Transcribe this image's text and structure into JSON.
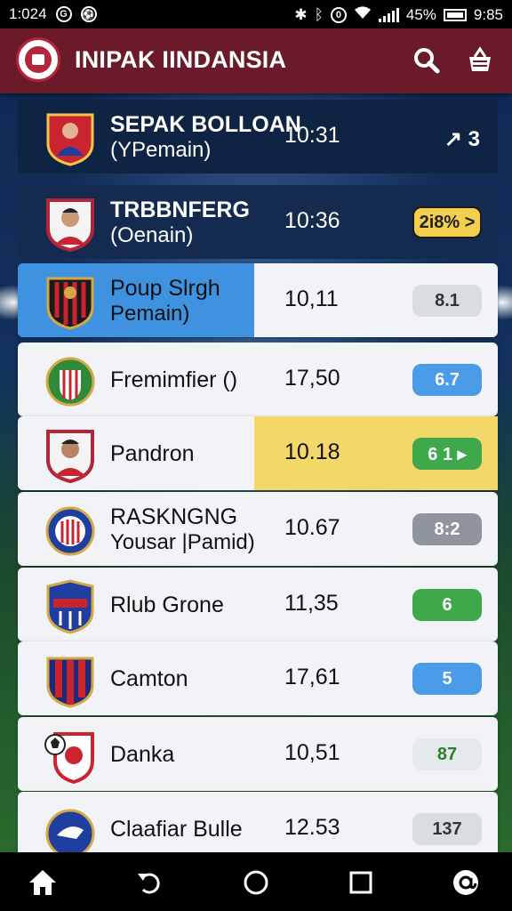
{
  "status_bar": {
    "time_left": "1:024",
    "battery_pct": "45%",
    "time_right": "9:85"
  },
  "app": {
    "title": "INIPAK IINDANSIA",
    "brand_color": "#6a1a28"
  },
  "rows": [
    {
      "name": "SEPAK BOLLOAN",
      "sub": "(YPemain)",
      "time": "10:31",
      "action": "↗ 3",
      "style": "dark"
    },
    {
      "name": "TRBBNFERG",
      "sub": "(Oenain)",
      "time": "10:36",
      "action": "2i8% >",
      "style": "dark"
    },
    {
      "name": "Poup Slrgh",
      "sub": "Pemain)",
      "time": "10,11",
      "action": "8.1",
      "style": "light-blue-highlight"
    },
    {
      "name": "Fremimfier ()",
      "sub": "",
      "time": "17,50",
      "action": "6.7",
      "style": "light"
    },
    {
      "name": "Pandron",
      "sub": "",
      "time": "10.18",
      "action": "6 1 ▸",
      "style": "light-yellow-highlight"
    },
    {
      "name": "RASKNGNG",
      "sub": "Yousar |Pamid)",
      "time": "10.67",
      "action": "8:2",
      "style": "light"
    },
    {
      "name": "Rlub Grone",
      "sub": "",
      "time": "11,35",
      "action": "6",
      "style": "light"
    },
    {
      "name": "Camton",
      "sub": "",
      "time": "17,61",
      "action": "5",
      "style": "light"
    },
    {
      "name": "Danka",
      "sub": "",
      "time": "10,51",
      "action": "87",
      "style": "light"
    },
    {
      "name": "Claafiar Bulle",
      "sub": "",
      "time": "12.53",
      "action": "137",
      "style": "light"
    }
  ]
}
